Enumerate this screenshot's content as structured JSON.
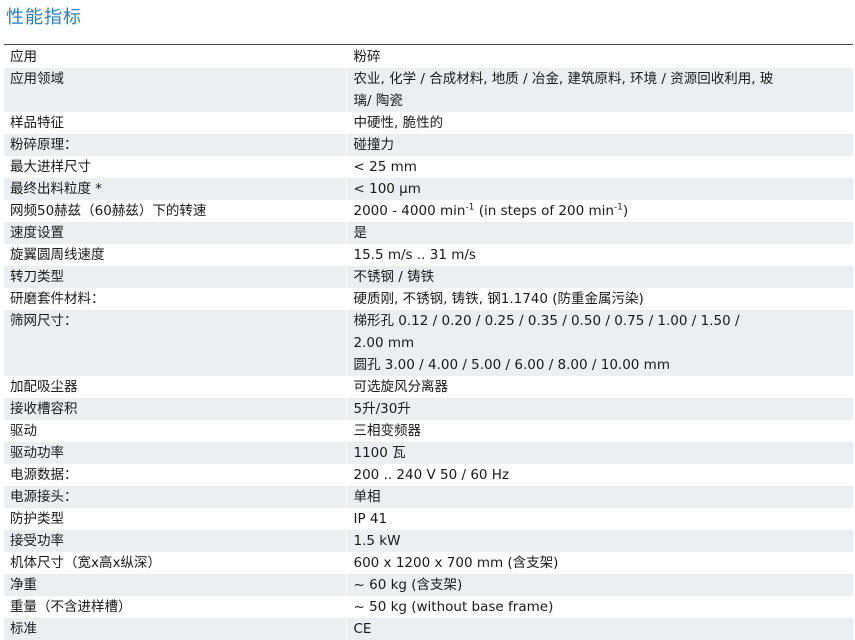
{
  "title": "性能指标",
  "rows": [
    {
      "label": "应用",
      "value": [
        "粉碎"
      ]
    },
    {
      "label": "应用领域",
      "value": [
        "农业, 化学 / 合成材料, 地质 / 冶金, 建筑原料, 环境 / 资源回收利用, 玻",
        "璃/ 陶瓷"
      ]
    },
    {
      "label": "样品特征",
      "value": [
        "中硬性, 脆性的"
      ]
    },
    {
      "label": "粉碎原理：",
      "value": [
        "碰撞力"
      ]
    },
    {
      "label": "最大进样尺寸",
      "value": [
        "< 25 mm"
      ]
    },
    {
      "label": "最终出料粒度 *",
      "value": [
        "< 100 µm"
      ]
    },
    {
      "label": "网频50赫兹（60赫兹）下的转速",
      "value_parts": {
        "a": "2000 - 4000 min",
        "sup1": "-1",
        "b": " (in steps of 200 min",
        "sup2": "-1",
        "c": ")"
      }
    },
    {
      "label": "速度设置",
      "value": [
        "是"
      ]
    },
    {
      "label": "旋翼圆周线速度",
      "value": [
        "15.5 m/s .. 31 m/s"
      ]
    },
    {
      "label": "转刀类型",
      "value": [
        "不锈钢 / 铸铁"
      ]
    },
    {
      "label": "研磨套件材料：",
      "value": [
        "硬质刚, 不锈钢, 铸铁, 钢1.1740 (防重金属污染)"
      ]
    },
    {
      "label": "筛网尺寸：",
      "value": [
        "梯形孔 0.12 / 0.20 / 0.25 / 0.35 / 0.50 / 0.75 / 1.00 / 1.50 /",
        "2.00 mm",
        "圆孔 3.00 / 4.00 / 5.00 / 6.00 / 8.00 / 10.00 mm"
      ]
    },
    {
      "label": "加配吸尘器",
      "value": [
        "可选旋风分离器"
      ]
    },
    {
      "label": "接收槽容积",
      "value": [
        "5升/30升"
      ]
    },
    {
      "label": "驱动",
      "value": [
        "三相变频器"
      ]
    },
    {
      "label": "驱动功率",
      "value": [
        "1100 瓦"
      ]
    },
    {
      "label": "电源数据：",
      "value": [
        "200 .. 240 V 50 / 60 Hz"
      ]
    },
    {
      "label": "电源接头：",
      "value": [
        "单相"
      ]
    },
    {
      "label": "防护类型",
      "value": [
        "IP 41"
      ]
    },
    {
      "label": "接受功率",
      "value": [
        "1.5 kW"
      ]
    },
    {
      "label": "机体尺寸（宽x高x纵深）",
      "value": [
        "600 x 1200 x 700 mm (含支架)"
      ]
    },
    {
      "label": "净重",
      "value": [
        "~ 60 kg (含支架)"
      ]
    },
    {
      "label": "重量（不含进样槽）",
      "value": [
        "~ 50 kg (without base frame)"
      ]
    },
    {
      "label": "标准",
      "value": [
        "CE"
      ]
    }
  ]
}
